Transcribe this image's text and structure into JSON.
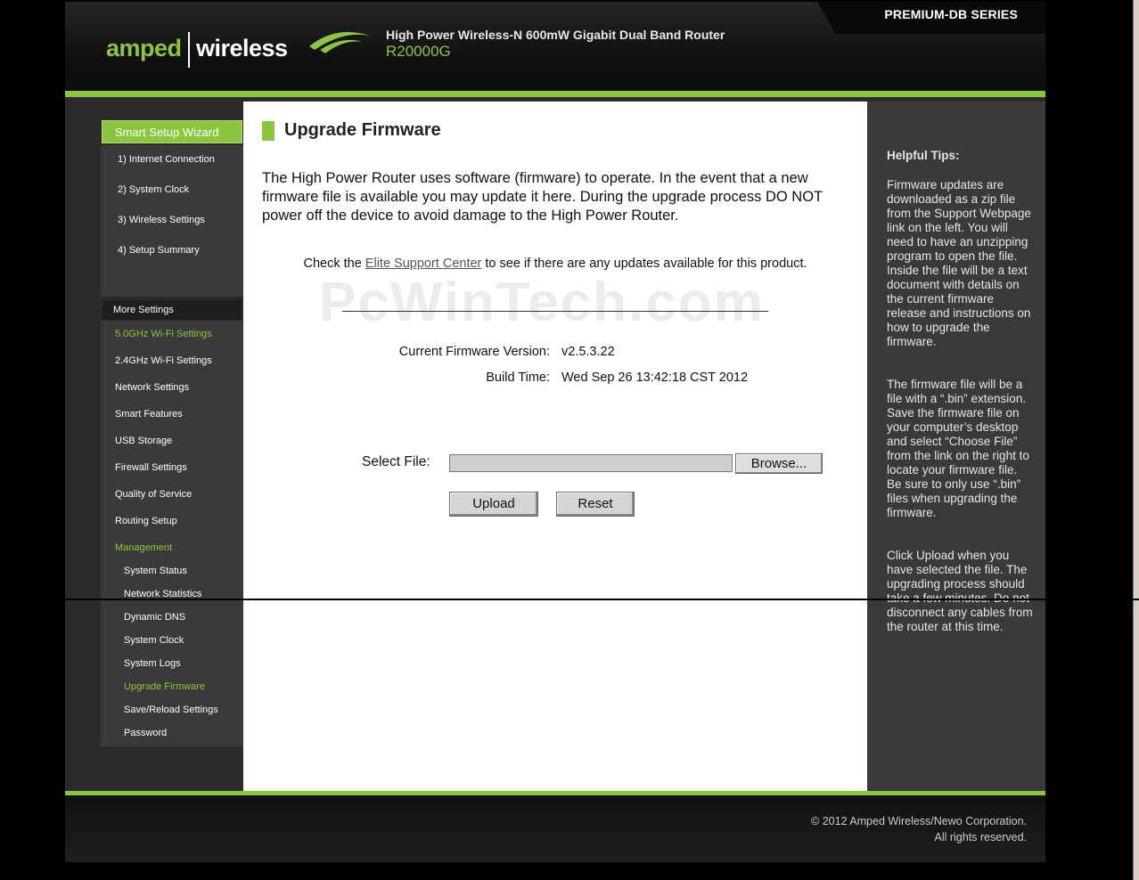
{
  "header": {
    "series": "PREMIUM-DB SERIES",
    "logo_left": "amped",
    "logo_right": "wireless",
    "product_name": "High Power Wireless-N 600mW Gigabit Dual Band Router",
    "model": "R20000G"
  },
  "sidebar": {
    "wizard_title": "Smart Setup Wizard",
    "wizard_items": [
      "1) Internet Connection",
      "2) System Clock",
      "3) Wireless Settings",
      "4) Setup Summary"
    ],
    "more_title": "More Settings",
    "items": [
      {
        "label": "5.0GHz Wi-Fi Settings"
      },
      {
        "label": "2.4GHz Wi-Fi Settings"
      },
      {
        "label": "Network Settings"
      },
      {
        "label": "Smart Features"
      },
      {
        "label": "USB Storage"
      },
      {
        "label": "Firewall Settings"
      },
      {
        "label": "Quality of Service"
      },
      {
        "label": "Routing Setup"
      },
      {
        "label": "Management"
      }
    ],
    "management_items": [
      {
        "label": "System Status"
      },
      {
        "label": "Network Statistics"
      },
      {
        "label": "Dynamic DNS"
      },
      {
        "label": "System Clock"
      },
      {
        "label": "System Logs"
      },
      {
        "label": "Upgrade Firmware"
      },
      {
        "label": "Save/Reload Settings"
      },
      {
        "label": "Password"
      }
    ]
  },
  "main": {
    "title": "Upgrade Firmware",
    "intro": "The High Power Router uses software (firmware) to operate. In the event that a new firmware file is available you may update it here. During the upgrade process DO NOT power off the device to avoid damage to the High Power Router.",
    "check_prefix": "Check the ",
    "check_link": "Elite Support Center",
    "check_suffix": " to see if there are any updates available for this product.",
    "watermark": "PcWinTech.com",
    "fw_version_label": "Current Firmware Version:",
    "fw_version_value": "v2.5.3.22",
    "build_time_label": "Build Time:",
    "build_time_value": "Wed Sep 26 13:42:18 CST 2012",
    "select_file_label": "Select File:",
    "browse_label": "Browse...",
    "upload_label": "Upload",
    "reset_label": "Reset"
  },
  "tips": {
    "title": "Helpful Tips:",
    "p1": "Firmware updates are downloaded as a zip file from the Support Webpage link on the left. You will need to have an unzipping program to open the file. Inside the file will be a text document with details on the current firmware release and instructions on how to upgrade the firmware.",
    "p2": "The firmware file will be a file with a “.bin” extension. Save the firmware file on your computer’s desktop and select “Choose File” from the link on the right to locate your firmware file. Be sure to only use “.bin” files when upgrading the firmware.",
    "p3": "Click Upload when you have selected the file. The upgrading process should take a few minutes. Do not disconnect any cables from the router at this time."
  },
  "footer": {
    "line1": "© 2012 Amped Wireless/Newo Corporation.",
    "line2": "All rights reserved."
  },
  "colors": {
    "accent": "#8cc63f",
    "panel": "#3a3a3a"
  }
}
